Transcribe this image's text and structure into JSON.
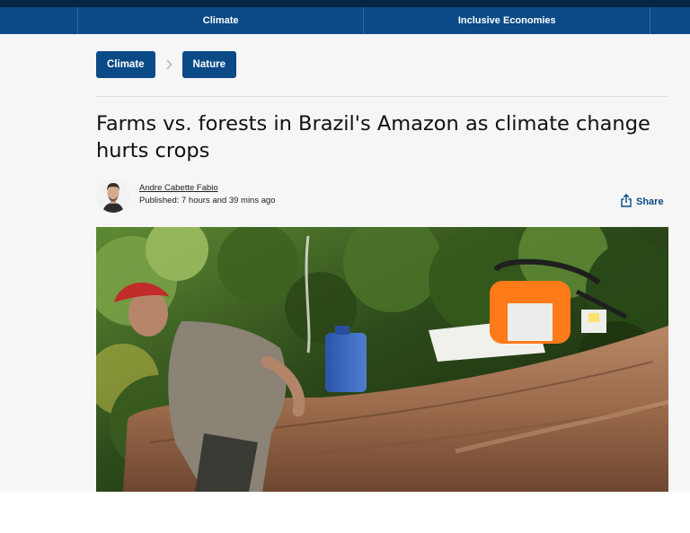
{
  "nav": {
    "items": [
      {
        "label": "Climate"
      },
      {
        "label": "Inclusive Economies"
      }
    ]
  },
  "tags": [
    {
      "label": "Climate"
    },
    {
      "label": "Nature"
    }
  ],
  "article": {
    "title": "Farms vs. forests in Brazil's Amazon as climate change hurts crops",
    "author": "Andre Cabette Fabio",
    "published": "Published: 7 hours and 39 mins ago",
    "share_label": "Share"
  },
  "icons": {
    "chevron": "chevron-right-icon",
    "share": "share-icon"
  },
  "colors": {
    "brand_navy": "#0a4a86",
    "top_strip": "#062444",
    "page_background": "#f6f6f6"
  }
}
